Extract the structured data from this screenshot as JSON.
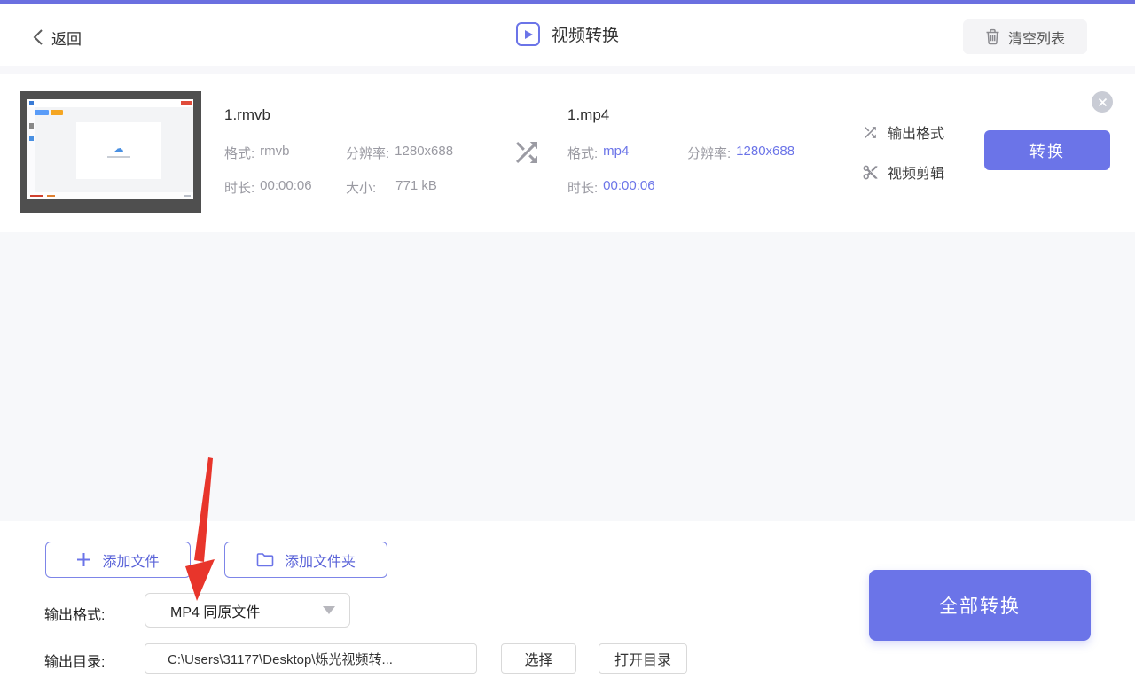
{
  "header": {
    "back_label": "返回",
    "title": "视频转换",
    "clear_list_label": "清空列表"
  },
  "file_row": {
    "source": {
      "name": "1.rmvb",
      "format_label": "格式:",
      "format_value": "rmvb",
      "resolution_label": "分辨率:",
      "resolution_value": "1280x688",
      "duration_label": "时长:",
      "duration_value": "00:00:06",
      "size_label": "大小:",
      "size_value": "771 kB"
    },
    "target": {
      "name": "1.mp4",
      "format_label": "格式:",
      "format_value": "mp4",
      "resolution_label": "分辨率:",
      "resolution_value": "1280x688",
      "duration_label": "时长:",
      "duration_value": "00:00:06"
    },
    "actions": {
      "output_format_label": "输出格式",
      "video_edit_label": "视频剪辑",
      "convert_label": "转换"
    }
  },
  "footer": {
    "add_file_label": "添加文件",
    "add_folder_label": "添加文件夹",
    "output_format_label": "输出格式:",
    "output_format_value": "MP4 同原文件",
    "output_dir_label": "输出目录:",
    "output_dir_value": "C:\\Users\\31177\\Desktop\\烁光视频转...",
    "select_label": "选择",
    "open_dir_label": "打开目录",
    "convert_all_label": "全部转换"
  },
  "colors": {
    "accent": "#6b74e8",
    "top_strip": "#6b6fe0",
    "muted_text": "#9a9aa2",
    "empty_background": "#f7f8fa",
    "red_arrow": "#e8352b"
  },
  "icons": {
    "back": "chevron-left",
    "title": "play-square",
    "clear": "trash",
    "transfer": "shuffle",
    "output_format": "shuffle",
    "video_edit": "scissors",
    "close": "circle-x",
    "add_file": "plus",
    "add_folder": "folder",
    "dropdown": "triangle-down"
  }
}
